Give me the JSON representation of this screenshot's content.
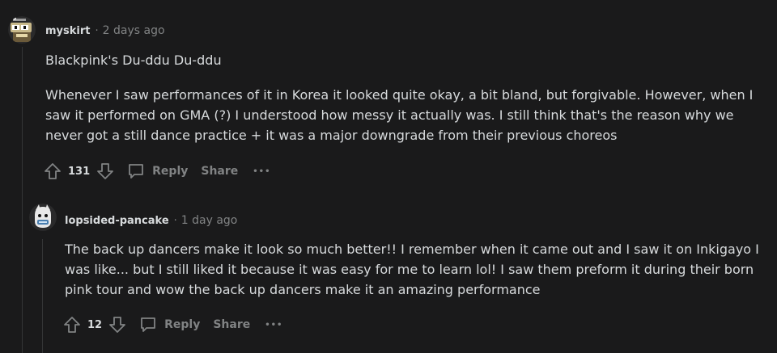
{
  "comments": [
    {
      "username": "myskirt",
      "separator": "·",
      "timestamp": "2 days ago",
      "paragraphs": [
        "Blackpink's Du-ddu Du-ddu",
        "Whenever I saw performances of it in Korea it looked quite okay, a bit bland, but forgivable. However, when I saw it performed on GMA (?) I understood how messy it actually was. I still think that's the reason why we never got a still dance practice + it was a major downgrade from their previous choreos"
      ],
      "votes": "131",
      "reply_label": "Reply",
      "share_label": "Share",
      "more_label": "•••"
    },
    {
      "username": "lopsided-pancake",
      "separator": "·",
      "timestamp": "1 day ago",
      "paragraphs": [
        "The back up dancers make it look so much better!! I remember when it came out and I saw it on Inkigayo I was like... but I still liked it because it was easy for me to learn lol! I saw them preform it during their born pink tour and wow the back up dancers make it an amazing performance"
      ],
      "votes": "12",
      "reply_label": "Reply",
      "share_label": "Share",
      "more_label": "•••"
    }
  ],
  "icons": {
    "upvote": "arrow-up-outline",
    "downvote": "arrow-down-outline",
    "reply": "speech-bubble-outline",
    "more": "ellipsis"
  },
  "colors": {
    "background": "#1a1a1b",
    "text": "#d7dadc",
    "muted": "#818384",
    "thread_line": "#343536"
  }
}
